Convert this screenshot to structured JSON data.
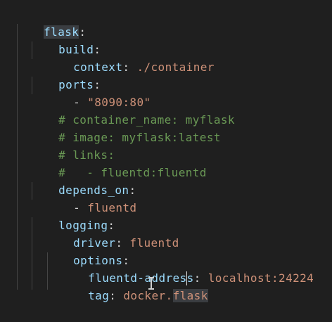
{
  "editor": {
    "lines": [
      {
        "key": "flask",
        "sep": ":"
      },
      {
        "key": "build",
        "sep": ":"
      },
      {
        "key": "context",
        "sep": ": ",
        "value": "./container"
      },
      {
        "key": "ports",
        "sep": ":"
      },
      {
        "dash": "- ",
        "value": "\"8090:80\""
      },
      {
        "comment": "# container_name: myflask"
      },
      {
        "comment": "# image: myflask:latest"
      },
      {
        "comment": "# links:"
      },
      {
        "comment": "#   - fluentd:fluentd"
      },
      {
        "key": "depends_on",
        "sep": ":"
      },
      {
        "dash": "- ",
        "value": "fluentd"
      },
      {
        "key": "logging",
        "sep": ":"
      },
      {
        "key": "driver",
        "sep": ": ",
        "value": "fluentd"
      },
      {
        "key": "options",
        "sep": ":"
      },
      {
        "key": "fluentd-address",
        "sep": ": ",
        "value": "localhost:24224"
      },
      {
        "key": "tag",
        "sep": ": ",
        "value_a": "docker.",
        "value_b": "flask"
      }
    ]
  },
  "colors": {
    "background": "#1f1f1f",
    "key": "#9cdcfe",
    "string": "#ce9178",
    "comment": "#6a9955"
  }
}
